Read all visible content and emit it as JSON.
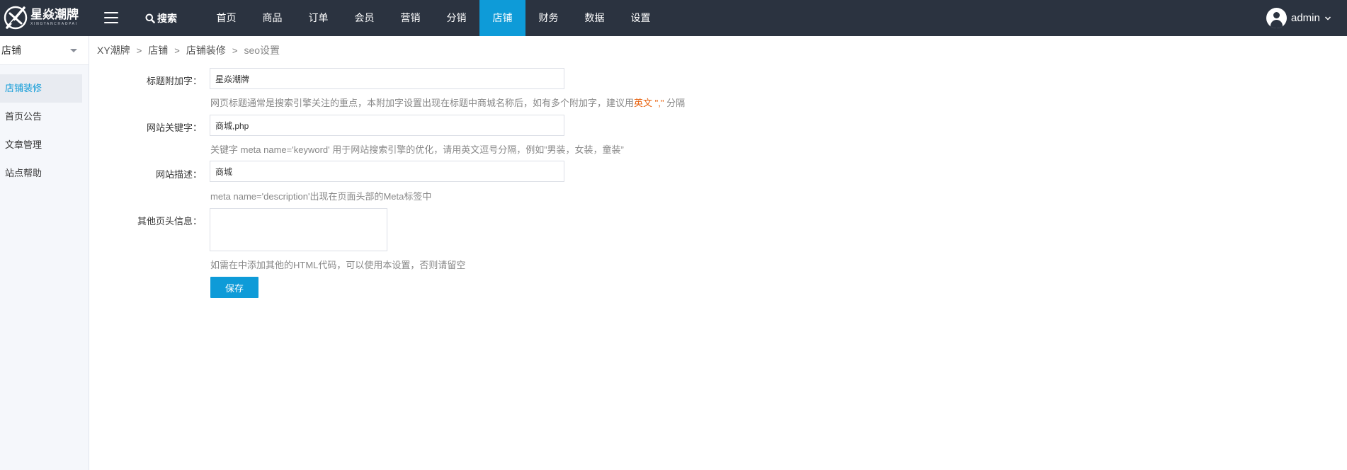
{
  "brand": {
    "name_cn": "星焱潮牌",
    "name_en": "XINGYANCHAOPAI"
  },
  "topbar": {
    "search_label": "搜索",
    "nav": [
      {
        "label": "首页",
        "active": false
      },
      {
        "label": "商品",
        "active": false
      },
      {
        "label": "订单",
        "active": false
      },
      {
        "label": "会员",
        "active": false
      },
      {
        "label": "营销",
        "active": false
      },
      {
        "label": "分销",
        "active": false
      },
      {
        "label": "店铺",
        "active": true
      },
      {
        "label": "财务",
        "active": false
      },
      {
        "label": "数据",
        "active": false
      },
      {
        "label": "设置",
        "active": false
      }
    ],
    "user_name": "admin"
  },
  "sidebar": {
    "title": "店铺",
    "items": [
      {
        "label": "店铺装修",
        "active": true
      },
      {
        "label": "首页公告",
        "active": false
      },
      {
        "label": "文章管理",
        "active": false
      },
      {
        "label": "站点帮助",
        "active": false
      }
    ]
  },
  "breadcrumb": {
    "items": [
      "XY潮牌",
      "店铺",
      "店铺装修"
    ],
    "current": "seo设置",
    "separator": ">"
  },
  "form": {
    "title_suffix": {
      "label": "标题附加字：",
      "value": "星焱潮牌",
      "hint_before": "网页标题通常是搜索引擎关注的重点，本附加字设置出现在标题中商城名称后，如有多个附加字，建议用",
      "hint_accent": "英文 \",\"",
      "hint_after": " 分隔"
    },
    "keywords": {
      "label": "网站关键字：",
      "value": "商城,php",
      "hint": "关键字 meta name='keyword' 用于网站搜索引擎的优化，请用英文逗号分隔，例如”男装，女装，童装”"
    },
    "description": {
      "label": "网站描述：",
      "value": "商城",
      "hint": "meta name='description'出现在页面头部的Meta标签中"
    },
    "other_head": {
      "label": "其他页头信息：",
      "value": "",
      "hint": "如需在中添加其他的HTML代码，可以使用本设置，否则请留空"
    },
    "save_label": "保存"
  },
  "colors": {
    "topbar_bg": "#2b3340",
    "accent": "#0e9bd8",
    "hint_accent": "#e8620f",
    "sidebar_bg": "#f5f7fb"
  }
}
